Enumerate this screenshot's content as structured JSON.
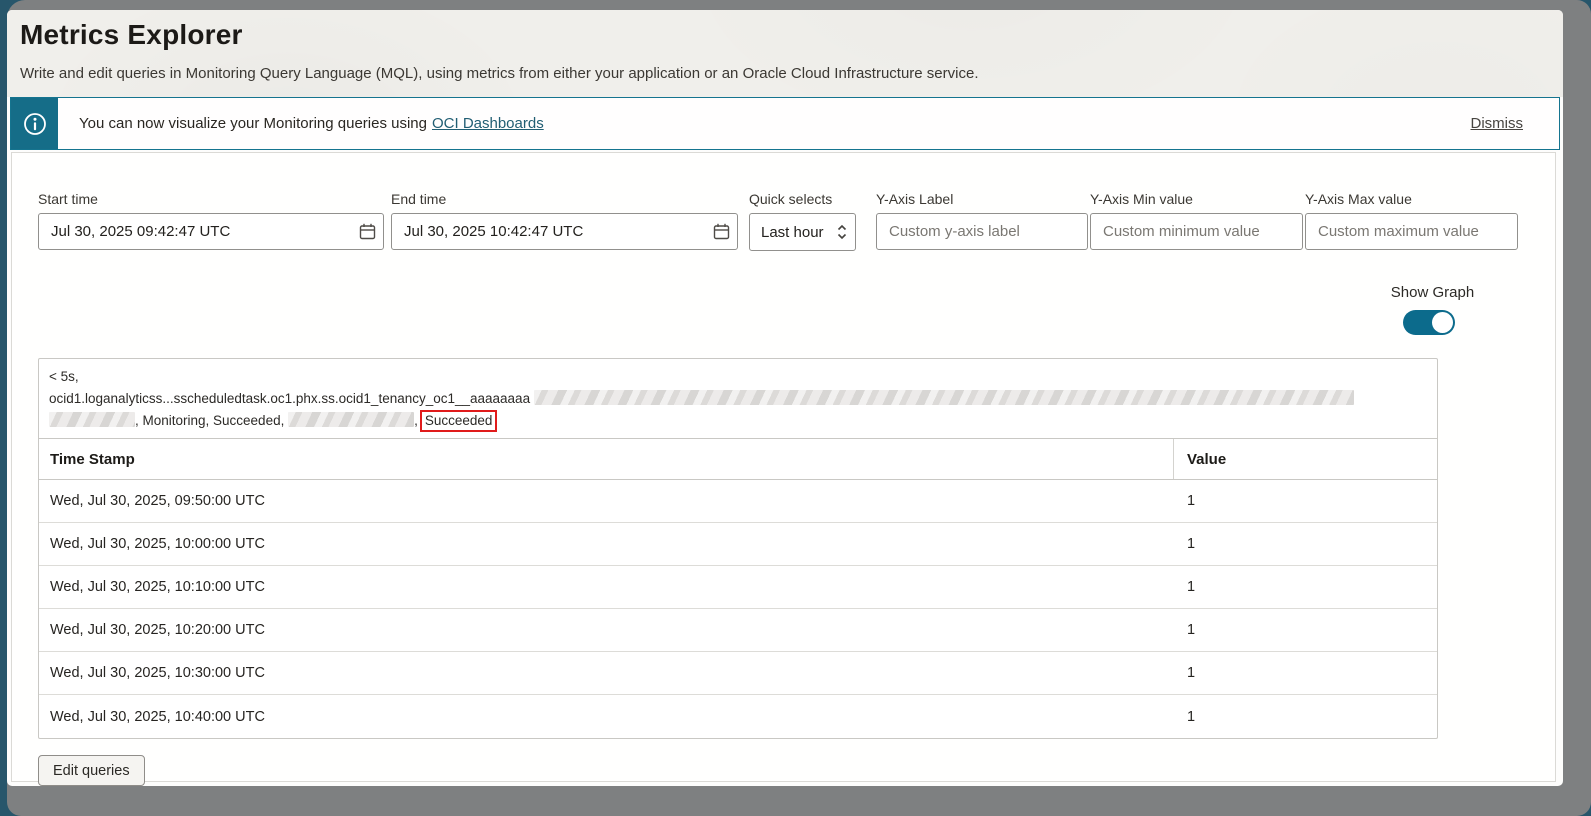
{
  "page": {
    "title": "Metrics Explorer",
    "subtitle": "Write and edit queries in Monitoring Query Language (MQL), using metrics from either your application or an Oracle Cloud Infrastructure service."
  },
  "banner": {
    "message": "You can now visualize your Monitoring queries using",
    "link_label": "OCI Dashboards",
    "dismiss_label": "Dismiss"
  },
  "controls": {
    "start_time": {
      "label": "Start time",
      "value": "Jul 30, 2025 09:42:47 UTC"
    },
    "end_time": {
      "label": "End time",
      "value": "Jul 30, 2025 10:42:47 UTC"
    },
    "quick_selects": {
      "label": "Quick selects",
      "value": "Last hour"
    },
    "y_axis_label": {
      "label": "Y-Axis Label",
      "placeholder": "Custom y-axis label"
    },
    "y_axis_min": {
      "label": "Y-Axis Min value",
      "placeholder": "Custom minimum value"
    },
    "y_axis_max": {
      "label": "Y-Axis Max value",
      "placeholder": "Custom maximum value"
    },
    "show_graph": {
      "label": "Show Graph",
      "state": "on"
    }
  },
  "query_legend": {
    "line1": "< 5s,",
    "line2_prefix": "ocid1.loganalyticss...sscheduledtask.oc1.phx.ss.ocid1_tenancy_oc1__aaaaaaaa",
    "line3_mid": ", Monitoring, Succeeded,",
    "line3_comma": ",",
    "highlighted_value": "Succeeded"
  },
  "table": {
    "columns": [
      "Time Stamp",
      "Value"
    ],
    "rows": [
      {
        "timestamp": "Wed, Jul 30, 2025, 09:50:00 UTC",
        "value": "1"
      },
      {
        "timestamp": "Wed, Jul 30, 2025, 10:00:00 UTC",
        "value": "1"
      },
      {
        "timestamp": "Wed, Jul 30, 2025, 10:10:00 UTC",
        "value": "1"
      },
      {
        "timestamp": "Wed, Jul 30, 2025, 10:20:00 UTC",
        "value": "1"
      },
      {
        "timestamp": "Wed, Jul 30, 2025, 10:30:00 UTC",
        "value": "1"
      },
      {
        "timestamp": "Wed, Jul 30, 2025, 10:40:00 UTC",
        "value": "1"
      }
    ]
  },
  "actions": {
    "edit_queries_label": "Edit queries"
  },
  "colors": {
    "accent_teal": "#156d88",
    "toggle_teal": "#0c6b8c",
    "highlight_red": "#e01b1b",
    "header_beige": "#f0efeb",
    "frame_gray": "#7e8081",
    "frame_teal": "#27566b"
  }
}
